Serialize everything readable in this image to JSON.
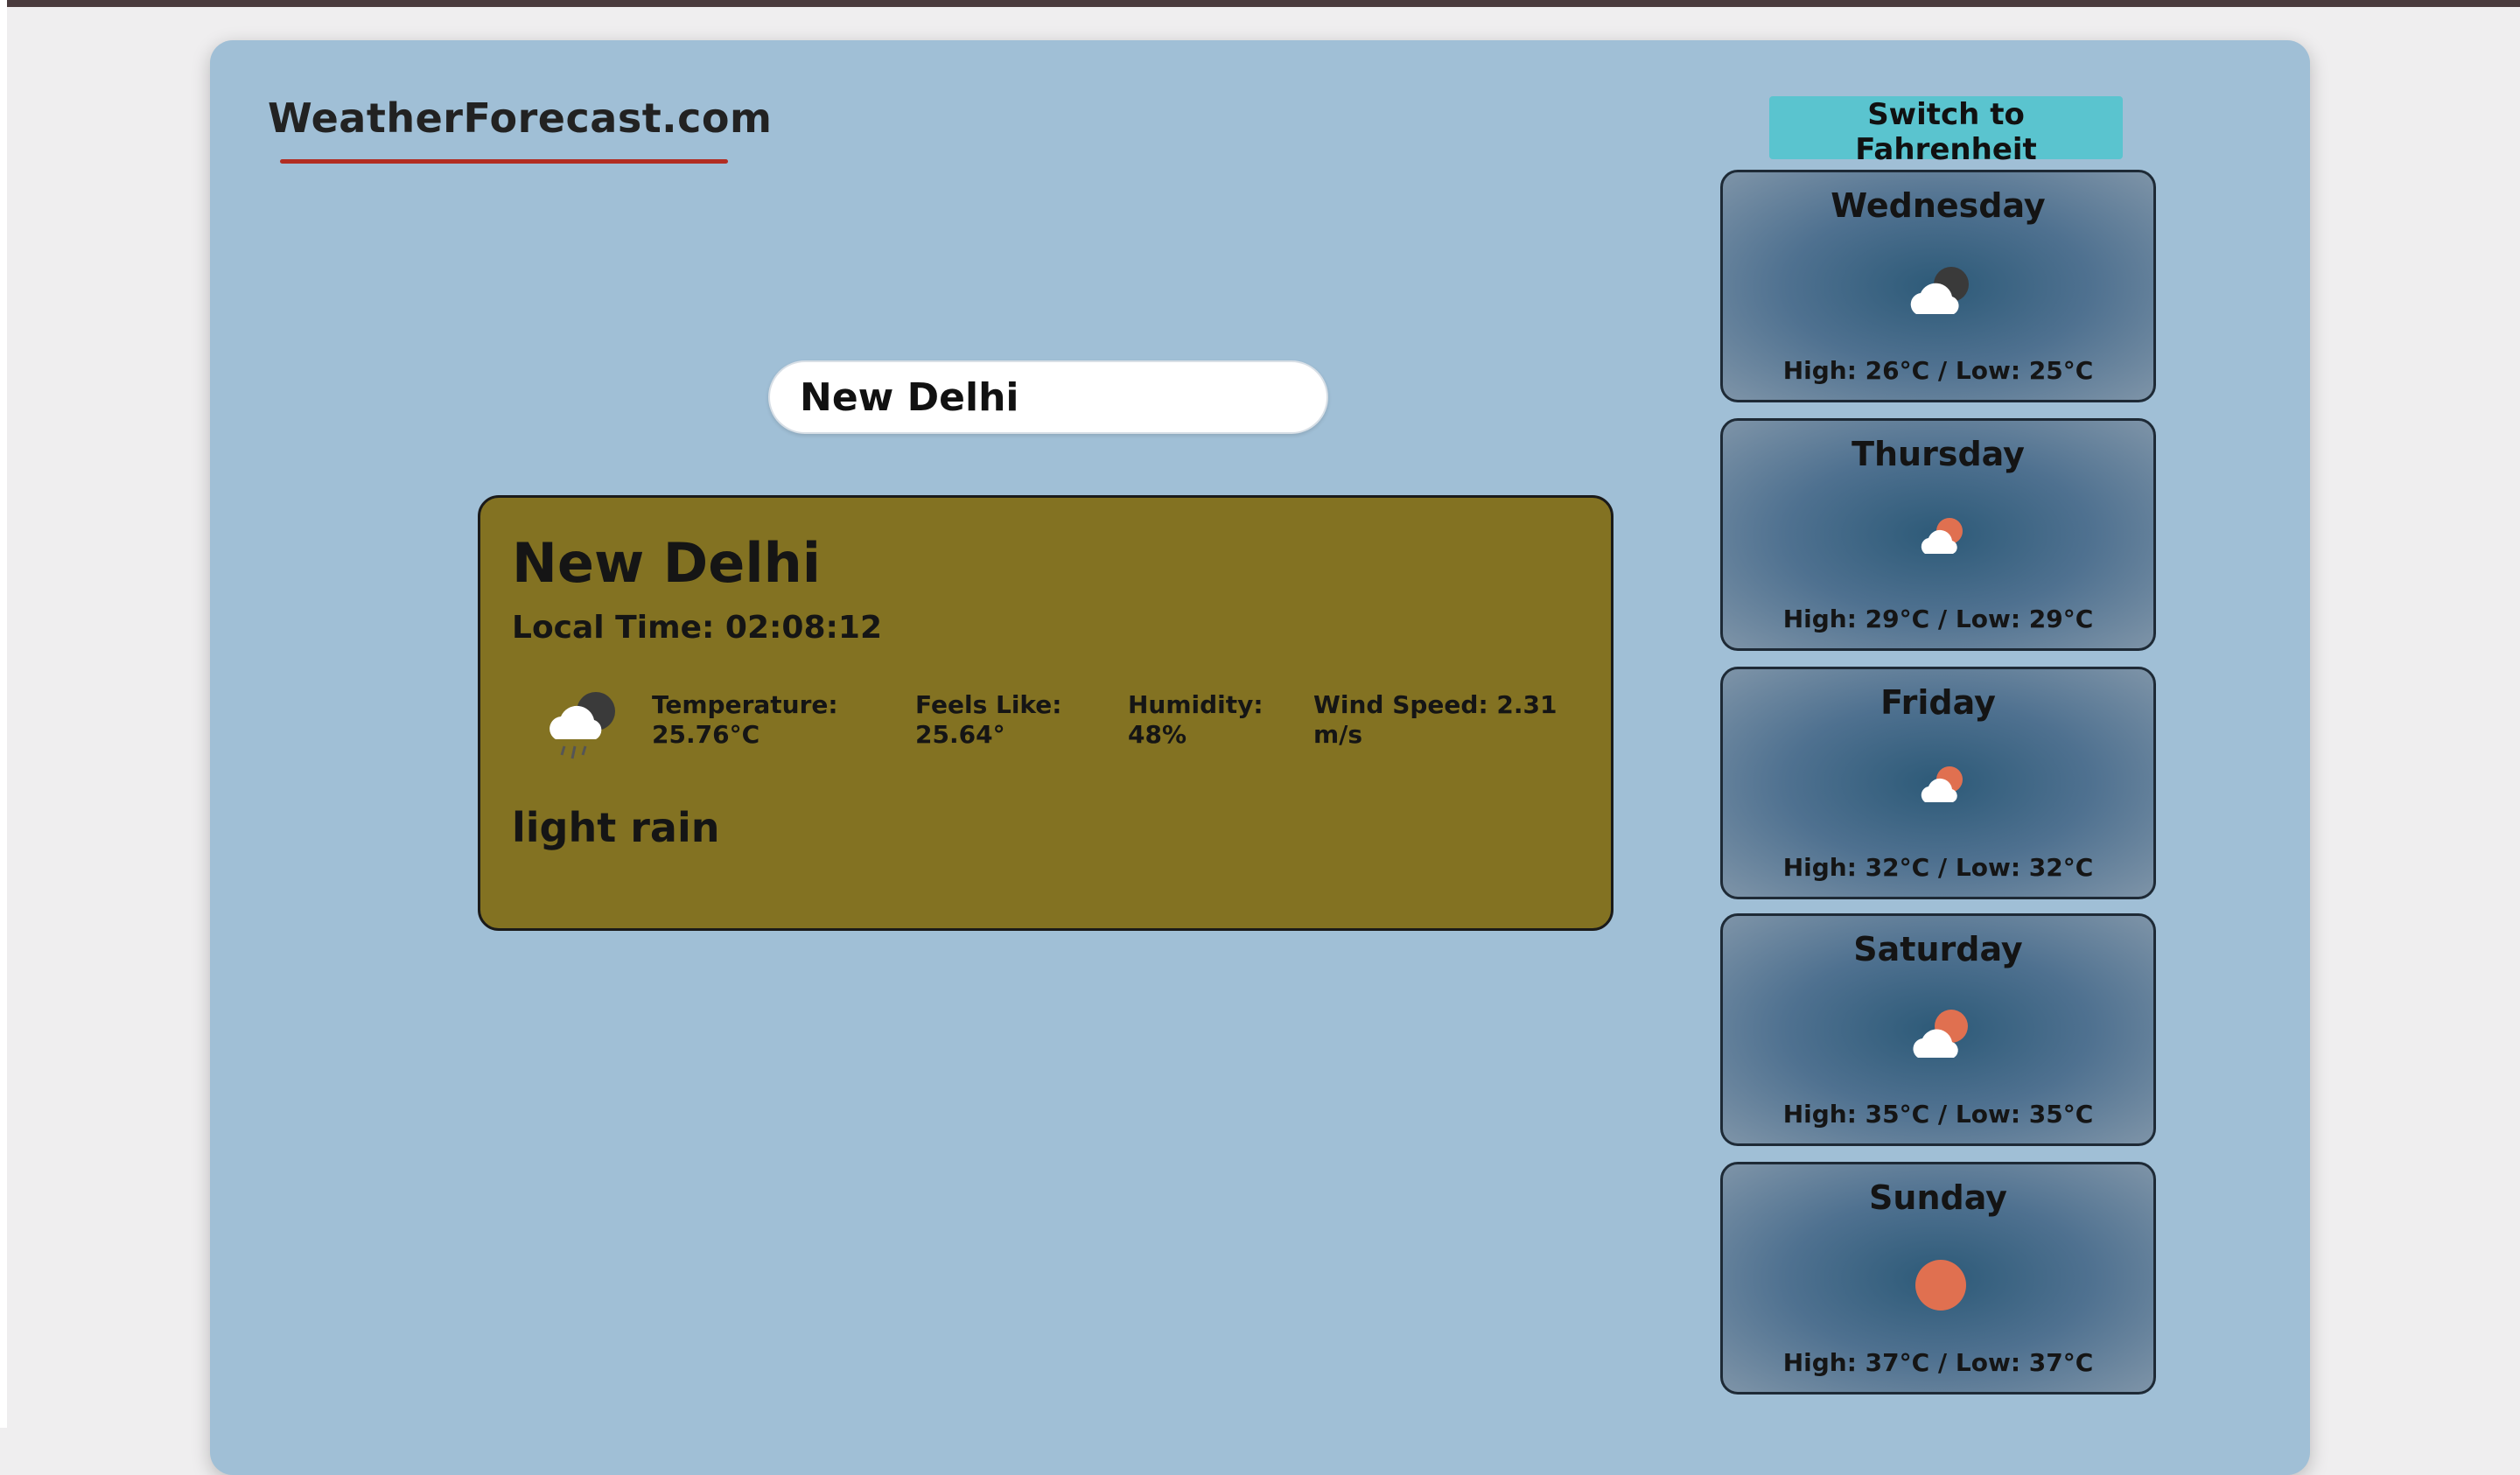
{
  "header": {
    "logo": "WeatherForecast.com",
    "unit_toggle_label": "Switch to Fahrenheit"
  },
  "search": {
    "value": "New Delhi"
  },
  "current": {
    "city": "New Delhi",
    "local_time": "Local Time: 02:08:12",
    "icon": "rain-night-icon",
    "temperature_label": "Temperature:",
    "temperature_value": "25.76°C",
    "feels_like_label": "Feels Like:",
    "feels_like_value": "25.64°",
    "humidity_label": "Humidity:",
    "humidity_value": "48%",
    "wind_label": "Wind Speed: 2.31",
    "wind_unit": "m/s",
    "description": "light rain"
  },
  "forecast": [
    {
      "day": "Wednesday",
      "icon": "cloud-night-icon",
      "temps": "High: 26°C / Low: 25°C"
    },
    {
      "day": "Thursday",
      "icon": "cloud-sun-icon",
      "temps": "High: 29°C / Low: 29°C"
    },
    {
      "day": "Friday",
      "icon": "cloud-sun-icon",
      "temps": "High: 32°C / Low: 32°C"
    },
    {
      "day": "Saturday",
      "icon": "cloud-sun-icon",
      "temps": "High: 35°C / Low: 35°C"
    },
    {
      "day": "Sunday",
      "icon": "sun-icon",
      "temps": "High: 37°C / Low: 37°C"
    }
  ],
  "colors": {
    "panel": "#a0bfd6",
    "current_card": "#837222",
    "accent_underline": "#b22d22",
    "button": "#5ac4cf",
    "sun": "#e07050"
  }
}
